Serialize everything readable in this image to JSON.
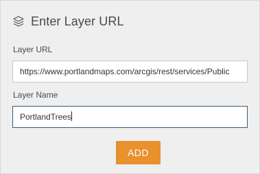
{
  "header": {
    "title": "Enter Layer URL",
    "icon": "layers-icon"
  },
  "form": {
    "url_label": "Layer URL",
    "url_value": "https://www.portlandmaps.com/arcgis/rest/services/Public",
    "name_label": "Layer Name",
    "name_value": "PortlandTrees"
  },
  "actions": {
    "add_label": "ADD"
  },
  "colors": {
    "accent": "#e8912d",
    "focus_border": "#3b5a7a",
    "panel_bg": "#efefef"
  }
}
